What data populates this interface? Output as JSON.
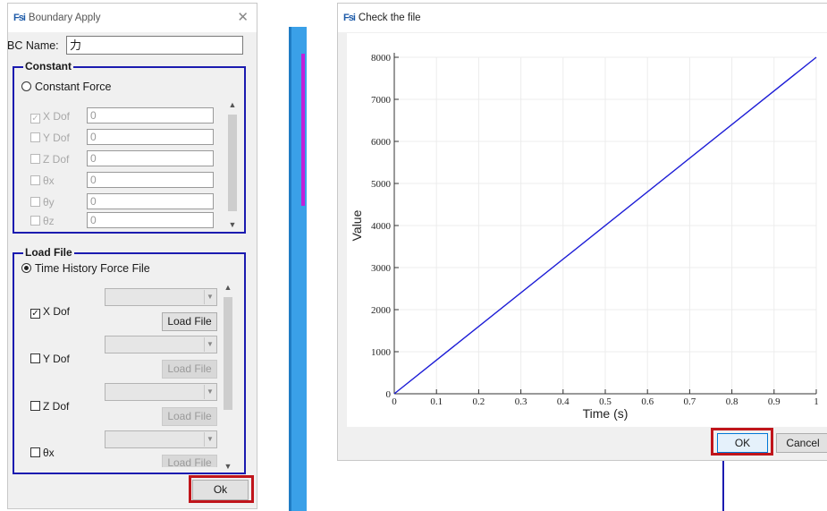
{
  "left_dialog": {
    "app_logo": "Fsi",
    "title": "Boundary Apply",
    "bc_name_label": "BC Name:",
    "bc_name_value": "力",
    "constant": {
      "group_title": "Constant",
      "radio_label": "Constant Force",
      "rows": [
        {
          "label": "X Dof",
          "value": "0",
          "checked": true
        },
        {
          "label": "Y Dof",
          "value": "0",
          "checked": false
        },
        {
          "label": "Z Dof",
          "value": "0",
          "checked": false
        },
        {
          "label": "θx",
          "value": "0",
          "checked": false
        },
        {
          "label": "θy",
          "value": "0",
          "checked": false
        },
        {
          "label": "θz",
          "value": "0",
          "checked": false
        }
      ]
    },
    "load_file": {
      "group_title": "Load File",
      "radio_label": "Time History Force File",
      "rows": [
        {
          "label": "X Dof",
          "button": "Load File",
          "checked": true
        },
        {
          "label": "Y Dof",
          "button": "Load File",
          "checked": false
        },
        {
          "label": "Z Dof",
          "button": "Load File",
          "checked": false
        },
        {
          "label": "θx",
          "button": "Load File",
          "checked": false
        }
      ]
    },
    "ok_button": "Ok"
  },
  "right_dialog": {
    "app_logo": "Fsi",
    "title": "Check the file",
    "ok_button": "OK",
    "cancel_button": "Cancel"
  },
  "chart_data": {
    "type": "line",
    "xlabel": "Time (s)",
    "ylabel": "Value",
    "xlim": [
      0,
      1
    ],
    "ylim": [
      0,
      8000
    ],
    "xticks": [
      "0",
      "0.1",
      "0.2",
      "0.3",
      "0.4",
      "0.5",
      "0.6",
      "0.7",
      "0.8",
      "0.9",
      "1"
    ],
    "yticks": [
      "0",
      "1000",
      "2000",
      "3000",
      "4000",
      "5000",
      "6000",
      "7000",
      "8000"
    ],
    "grid": true,
    "series": [
      {
        "x": [
          0,
          1
        ],
        "y": [
          0,
          8000
        ],
        "color": "#1c1cd6"
      }
    ]
  }
}
